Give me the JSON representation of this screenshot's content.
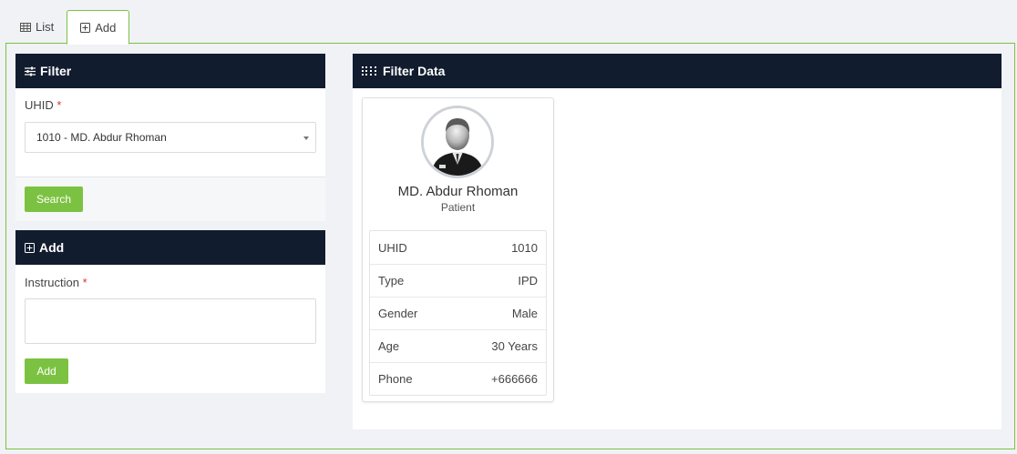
{
  "tabs": [
    {
      "label": "List",
      "icon": "table-icon"
    },
    {
      "label": "Add",
      "icon": "plus-square-icon"
    }
  ],
  "filter": {
    "title": "Filter",
    "uhid_label": "UHID",
    "required_mark": "*",
    "uhid_value": "1010 - MD. Abdur Rhoman",
    "search_label": "Search"
  },
  "add": {
    "title": "Add",
    "instruction_label": "Instruction",
    "required_mark": "*",
    "instruction_value": "",
    "add_label": "Add"
  },
  "filter_data": {
    "title": "Filter Data",
    "patient": {
      "name": "MD. Abdur Rhoman",
      "role": "Patient",
      "rows": [
        {
          "label": "UHID",
          "value": "1010"
        },
        {
          "label": "Type",
          "value": "IPD"
        },
        {
          "label": "Gender",
          "value": "Male"
        },
        {
          "label": "Age",
          "value": "30 Years"
        },
        {
          "label": "Phone",
          "value": "+666666"
        }
      ]
    }
  },
  "colors": {
    "accent": "#7cc242",
    "panel_header": "#111c2e",
    "required": "#d9362b",
    "background": "#f0f2f5"
  }
}
